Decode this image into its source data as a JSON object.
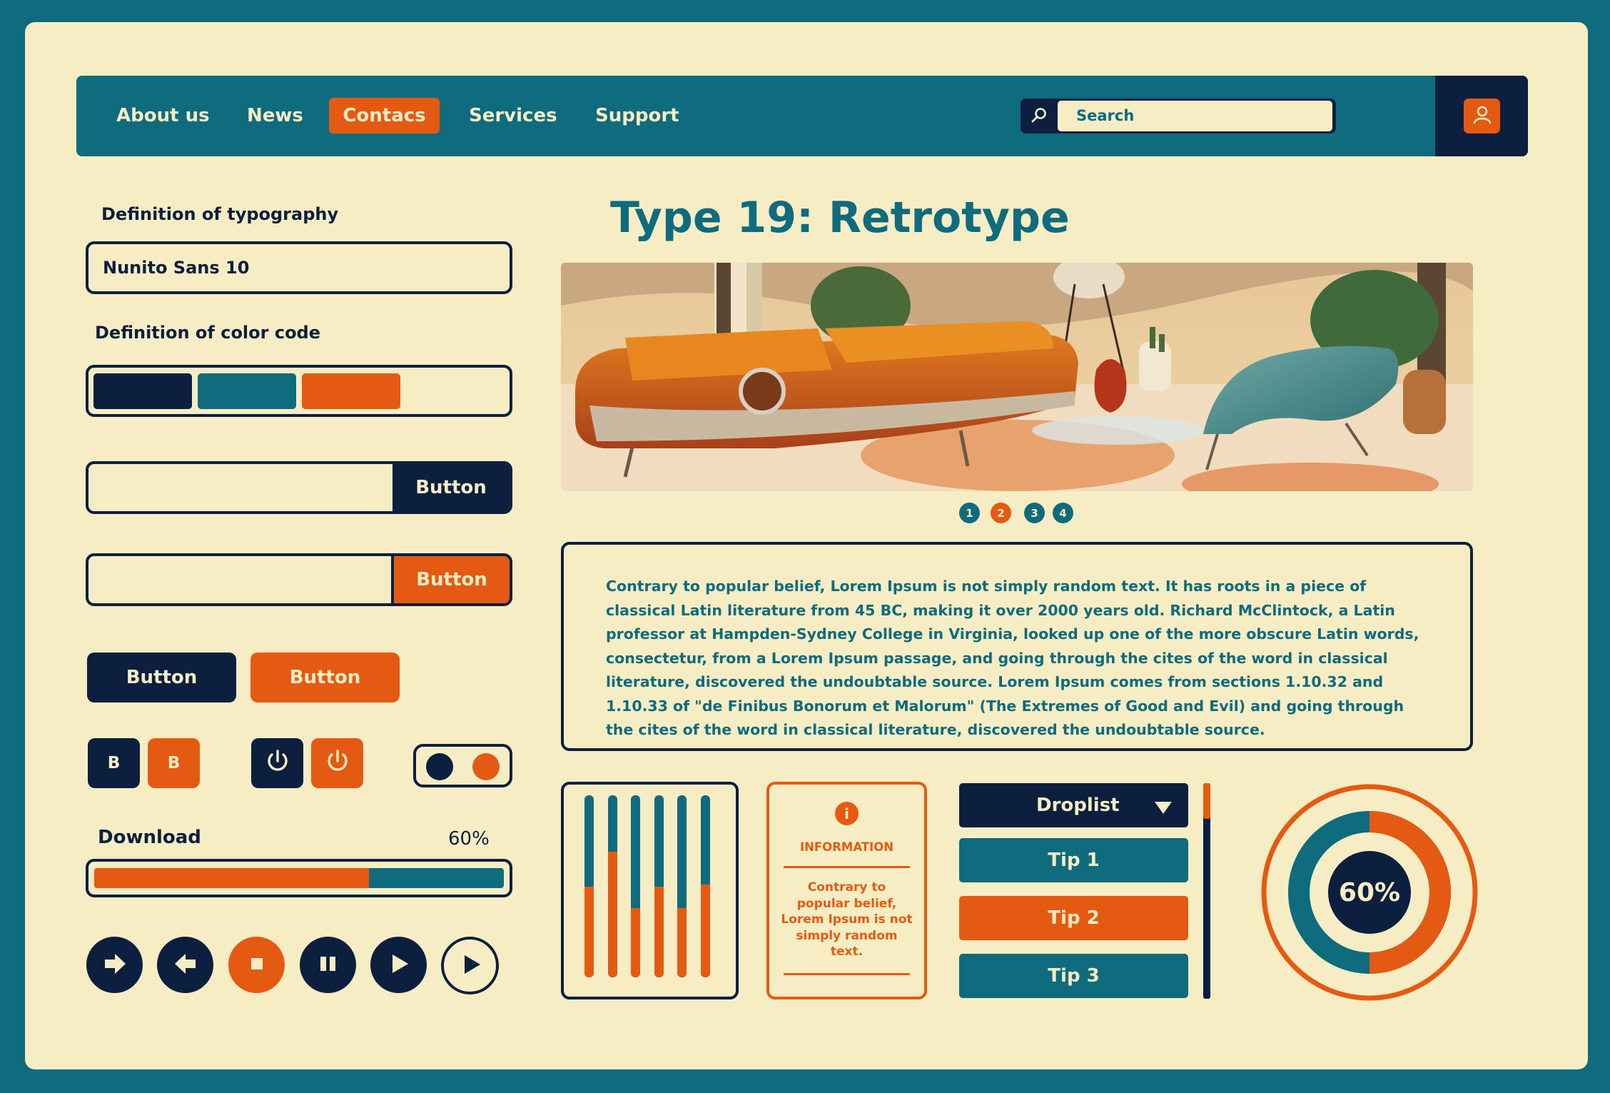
{
  "nav": {
    "items": [
      "About us",
      "News",
      "Contacs",
      "Services",
      "Support"
    ],
    "active": "Contacs",
    "search_placeholder": "Search"
  },
  "left": {
    "typography_label": "Definition of typography",
    "typography_value": "Nunito Sans 10",
    "color_label": "Definition of color code",
    "color_swatches": [
      "#0c1f3f",
      "#0f6b7e",
      "#e55a12",
      "#f6edc4"
    ],
    "input_button_1": "Button",
    "input_button_2": "Button",
    "button_navy": "Button",
    "button_orange": "Button",
    "bold_navy": "B",
    "bold_orange": "B",
    "download_label": "Download",
    "download_percent": "60%",
    "download_progress": 0.67
  },
  "main": {
    "title": "Type 19: Retrotype",
    "carousel_dots": [
      "1",
      "2",
      "3",
      "4"
    ],
    "active_dot": "2",
    "paragraph": "Contrary to popular belief, Lorem Ipsum is not simply random text. It has roots in a piece of classical Latin literature from 45 BC, making it over 2000 years old. Richard McClintock, a Latin professor at Hampden-Sydney College in Virginia, looked up one of the more obscure Latin words, consectetur, from a Lorem Ipsum passage, and going through the cites of the word in classical literature, discovered the undoubtable source. Lorem Ipsum comes from sections 1.10.32 and 1.10.33 of \"de Finibus Bonorum et Malorum\" (The Extremes of Good and Evil) and going through the cites of the word in classical literature, discovered the undoubtable source."
  },
  "widgets": {
    "bar_levels": [
      0.5,
      0.69,
      0.38,
      0.5,
      0.38,
      0.51
    ],
    "info_icon": "i",
    "info_title": "INFORMATION",
    "info_text": "Contrary to popular belief, Lorem Ipsum is not simply random text.",
    "droplist_label": "Droplist",
    "tips": [
      "Tip 1",
      "Tip 2",
      "Tip 3"
    ],
    "donut_label": "60%",
    "donut_value": 0.5
  },
  "colors": {
    "navy": "#0c1f3f",
    "teal": "#0f6b7e",
    "orange": "#e55a12",
    "cream": "#f6edc4"
  }
}
